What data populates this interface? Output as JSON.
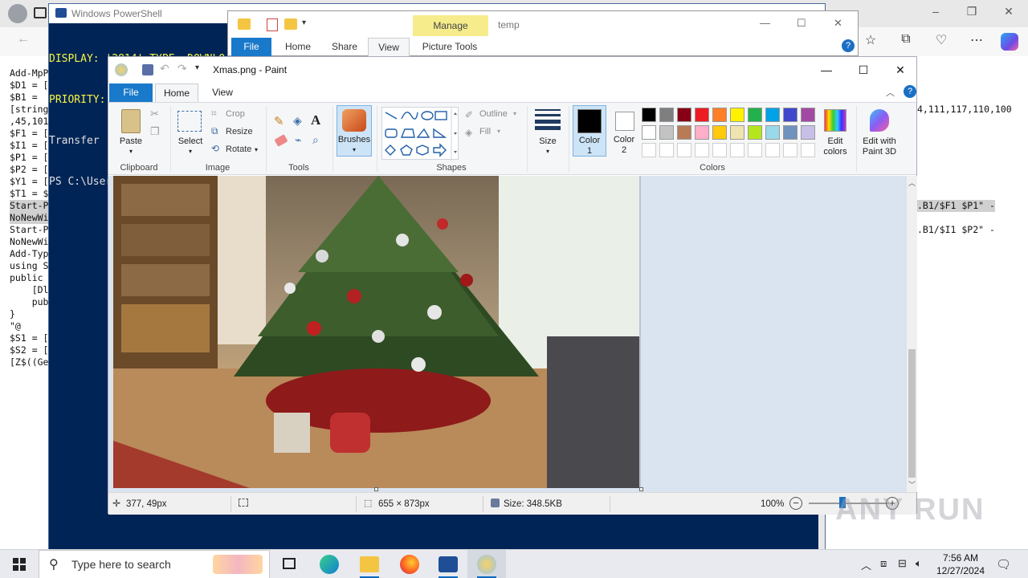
{
  "browser": {
    "window_controls": [
      "–",
      "❐",
      "✕"
    ],
    "right_console_lines": [
      "4,111,117,110,100",
      ".B1/$F1 $P1\" -",
      ".B1/$I1 $P2\" -"
    ]
  },
  "console_left": [
    "Add-MpP",
    "$D1 = [",
    "$B1 =",
    "[string",
    ",45,101",
    "$F1 = [",
    "$I1 = [",
    "$P1 = [",
    "$P2 = [",
    "$Y1 = [",
    "$T1 = $",
    "Start-P",
    "NoNewWi",
    "Start-P",
    "NoNewWi",
    "Add-Typ",
    "using S",
    "public",
    "    [Dl",
    "    pub",
    "}",
    "\"@",
    "$S1 = [",
    "$S2 = [",
    "[Z$((Ge"
  ],
  "powershell": {
    "title": "Windows PowerShell",
    "line1": "DISPLAY: '2814' TYPE: DOWNLO",
    "line2": "PRIORITY: NORMAL FILES: 1 /",
    "line3": "Transfer",
    "line4": "PS C:\\User"
  },
  "explorer": {
    "manage_label": "Manage",
    "folder_title": "temp",
    "tabs": [
      "File",
      "Home",
      "Share",
      "View",
      "Picture Tools"
    ],
    "window_controls": [
      "—",
      "☐",
      "✕"
    ]
  },
  "paint": {
    "title": "Xmas.png - Paint",
    "window_controls": [
      "—",
      "☐",
      "✕"
    ],
    "tabs": [
      "File",
      "Home",
      "View"
    ],
    "clipboard": {
      "paste": "Paste",
      "label": "Clipboard"
    },
    "image": {
      "select": "Select",
      "crop": "Crop",
      "resize": "Resize",
      "rotate": "Rotate",
      "label": "Image"
    },
    "tools": {
      "label": "Tools"
    },
    "brushes": {
      "label": "Brushes"
    },
    "shapes": {
      "outline": "Outline",
      "fill": "Fill",
      "label": "Shapes"
    },
    "size": {
      "label": "Size"
    },
    "colors": {
      "color1": "Color\n1",
      "color2": "Color\n2",
      "edit_colors": "Edit\ncolors",
      "label": "Colors",
      "color1_value": "#000000",
      "color2_value": "#ffffff",
      "palette_row1": [
        "#000000",
        "#7f7f7f",
        "#880015",
        "#ed1c24",
        "#ff7f27",
        "#fff200",
        "#22b14c",
        "#00a2e8",
        "#3f48cc",
        "#a349a4"
      ],
      "palette_row2": [
        "#ffffff",
        "#c3c3c3",
        "#b97a57",
        "#ffaec9",
        "#ffc90e",
        "#efe4b0",
        "#b5e61d",
        "#99d9ea",
        "#7092be",
        "#c8bfe7"
      ]
    },
    "paint3d": "Edit with\nPaint 3D",
    "status": {
      "cursor": "377, 49px",
      "dimensions": "655 × 873px",
      "size": "Size: 348.5KB",
      "zoom": "100%"
    }
  },
  "taskbar": {
    "search_placeholder": "Type here to search",
    "time": "7:56 AM",
    "date": "12/27/2024"
  },
  "watermark": "ANY RUN"
}
